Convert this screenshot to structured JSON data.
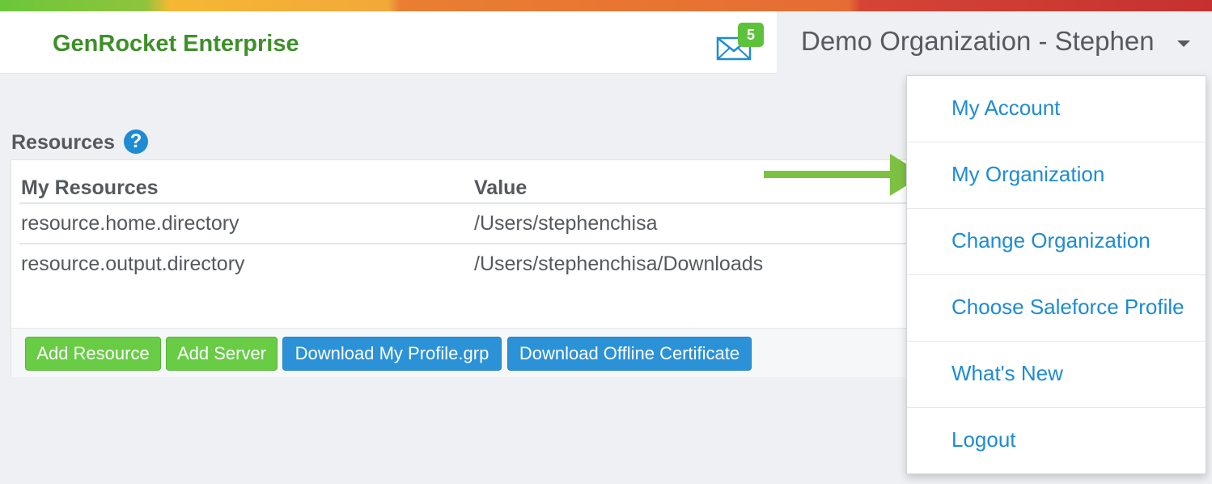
{
  "header": {
    "brand": "GenRocket Enterprise",
    "mail_count": "5",
    "org_user": "Demo Organization - Stephen"
  },
  "resources": {
    "title": "Resources",
    "help_glyph": "?",
    "columns": [
      "My Resources",
      "Value"
    ],
    "rows": [
      {
        "name": "resource.home.directory",
        "value": "/Users/stephenchisa"
      },
      {
        "name": "resource.output.directory",
        "value": "/Users/stephenchisa/Downloads"
      }
    ],
    "buttons": {
      "add_resource": "Add Resource",
      "add_server": "Add Server",
      "download_profile": "Download My Profile.grp",
      "download_certificate": "Download Offline Certificate"
    }
  },
  "dropdown": {
    "items": [
      "My Account",
      "My Organization",
      "Change Organization",
      "Choose Saleforce Profile",
      "What's New",
      "Logout"
    ]
  },
  "colors": {
    "brand": "#3e8f29",
    "link": "#1e8bd4",
    "button_green": "#68cc45",
    "button_blue": "#2b92d8",
    "arrow": "#7dc143"
  }
}
